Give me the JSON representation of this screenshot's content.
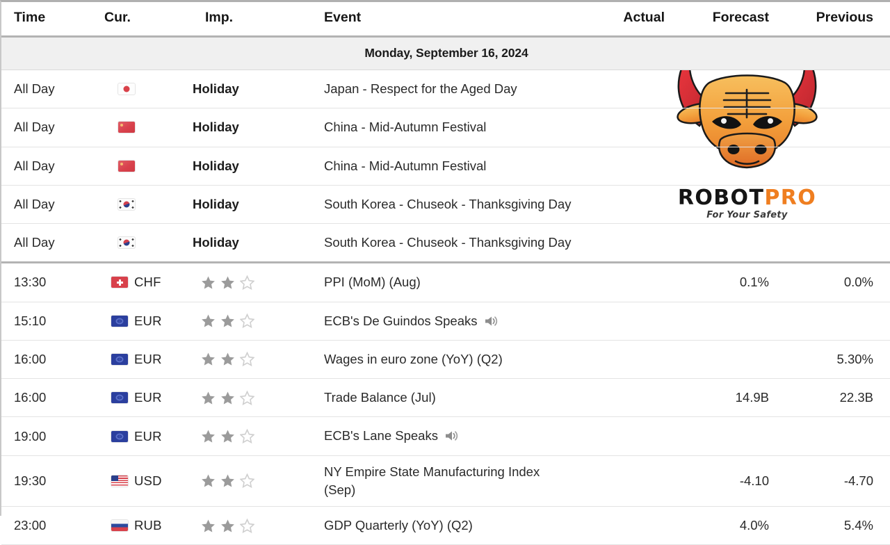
{
  "table": {
    "columns": [
      {
        "key": "time",
        "label": "Time",
        "align": "left"
      },
      {
        "key": "cur",
        "label": "Cur.",
        "align": "left"
      },
      {
        "key": "imp",
        "label": "Imp.",
        "align": "left"
      },
      {
        "key": "event",
        "label": "Event",
        "align": "left"
      },
      {
        "key": "actual",
        "label": "Actual",
        "align": "right"
      },
      {
        "key": "forecast",
        "label": "Forecast",
        "align": "right"
      },
      {
        "key": "previous",
        "label": "Previous",
        "align": "right"
      }
    ],
    "date_header": "Monday, September 16, 2024",
    "rows": [
      {
        "time": "All Day",
        "flag": "japan-flag",
        "currency": "",
        "importance_label": "Holiday",
        "stars_filled": 0,
        "event": "Japan - Respect for the Aged Day",
        "has_speaker": false,
        "actual": "",
        "forecast": "",
        "previous": ""
      },
      {
        "time": "All Day",
        "flag": "china-flag",
        "currency": "",
        "importance_label": "Holiday",
        "stars_filled": 0,
        "event": "China - Mid-Autumn Festival",
        "has_speaker": false,
        "actual": "",
        "forecast": "",
        "previous": ""
      },
      {
        "time": "All Day",
        "flag": "china-flag",
        "currency": "",
        "importance_label": "Holiday",
        "stars_filled": 0,
        "event": "China - Mid-Autumn Festival",
        "has_speaker": false,
        "actual": "",
        "forecast": "",
        "previous": ""
      },
      {
        "time": "All Day",
        "flag": "south-korea-flag",
        "currency": "",
        "importance_label": "Holiday",
        "stars_filled": 0,
        "event": "South Korea - Chuseok - Thanksgiving Day",
        "has_speaker": false,
        "actual": "",
        "forecast": "",
        "previous": ""
      },
      {
        "time": "All Day",
        "flag": "south-korea-flag",
        "currency": "",
        "importance_label": "Holiday",
        "stars_filled": 0,
        "event": "South Korea - Chuseok - Thanksgiving Day",
        "has_speaker": false,
        "actual": "",
        "forecast": "",
        "previous": "",
        "section_end": true
      },
      {
        "time": "13:30",
        "flag": "switzerland-flag",
        "currency": "CHF",
        "importance_label": "",
        "stars_filled": 2,
        "event": "PPI (MoM) (Aug)",
        "has_speaker": false,
        "actual": "",
        "forecast": "0.1%",
        "previous": "0.0%"
      },
      {
        "time": "15:10",
        "flag": "european-union-flag",
        "currency": "EUR",
        "importance_label": "",
        "stars_filled": 2,
        "event": "ECB's De Guindos Speaks",
        "has_speaker": true,
        "actual": "",
        "forecast": "",
        "previous": ""
      },
      {
        "time": "16:00",
        "flag": "european-union-flag",
        "currency": "EUR",
        "importance_label": "",
        "stars_filled": 2,
        "event": "Wages in euro zone (YoY) (Q2)",
        "has_speaker": false,
        "actual": "",
        "forecast": "",
        "previous": "5.30%"
      },
      {
        "time": "16:00",
        "flag": "european-union-flag",
        "currency": "EUR",
        "importance_label": "",
        "stars_filled": 2,
        "event": "Trade Balance (Jul)",
        "has_speaker": false,
        "actual": "",
        "forecast": "14.9B",
        "previous": "22.3B"
      },
      {
        "time": "19:00",
        "flag": "european-union-flag",
        "currency": "EUR",
        "importance_label": "",
        "stars_filled": 2,
        "event": "ECB's Lane Speaks",
        "has_speaker": true,
        "actual": "",
        "forecast": "",
        "previous": ""
      },
      {
        "time": "19:30",
        "flag": "united-states-flag",
        "currency": "USD",
        "importance_label": "",
        "stars_filled": 2,
        "event": "NY Empire State Manufacturing Index (Sep)",
        "has_speaker": false,
        "actual": "",
        "forecast": "-4.10",
        "previous": "-4.70",
        "two_line": true
      },
      {
        "time": "23:00",
        "flag": "russia-flag",
        "currency": "RUB",
        "importance_label": "",
        "stars_filled": 2,
        "event": "GDP Quarterly (YoY) (Q2)",
        "has_speaker": false,
        "actual": "",
        "forecast": "4.0%",
        "previous": "5.4%"
      }
    ]
  },
  "watermark": {
    "icon": "bull-head-logo",
    "brand_primary": "ROBOT",
    "brand_accent": "PRO",
    "tagline": "For Your Safety",
    "accent_color": "#ef7e20",
    "primary_color": "#151515"
  },
  "theme": {
    "star_filled_color": "#9b9b9b",
    "star_empty_color": "#cfcfcf",
    "header_rule_color": "#b3b3b3",
    "row_rule_color": "#e3e3e3",
    "date_row_bg": "#f0f0f0"
  }
}
